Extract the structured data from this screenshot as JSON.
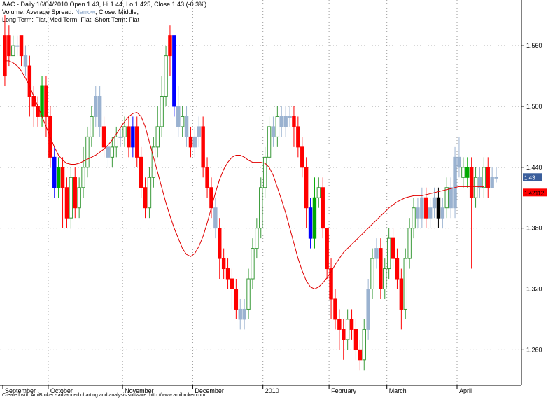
{
  "header": {
    "line1": "AAC - Daily 16/04/2010 Open 1.43, Hi 1.44, Lo 1.425, Close 1.43 (-0.3%)",
    "line2_prefix": "Volume: Average Spread:",
    "line2_narrow": "Narrow",
    "line2_suffix": ", Close: Middle,",
    "line3": "Long Term: Flat, Med Term: Flat, Short Term: Flat"
  },
  "footer": "Created with AmiBroker - advanced charting and analysis software. http://www.amibroker.com",
  "colors": {
    "up_body": "#ffffff",
    "up_border": "#3a9a3a",
    "down_body": "#ff0000",
    "neutral": "#9ab2d0",
    "ma_line": "#e00000",
    "grid": "#999999",
    "price_badge": "#3a5e9c",
    "ma_badge": "#ff0000"
  },
  "chart_data": {
    "type": "candlestick",
    "ylim": [
      1.225,
      1.605
    ],
    "y_ticks": [
      "1.560",
      "1.500",
      "1.440",
      "1.380",
      "1.320",
      "1.260"
    ],
    "x_labels": [
      "September",
      "October",
      "November",
      "December",
      "2010",
      "February",
      "March",
      "April"
    ],
    "last_price_label": "1.43",
    "ma_label": "1.42112",
    "candles": [
      [
        1.53,
        1.57,
        1.59,
        1.52,
        "d"
      ],
      [
        1.57,
        1.55,
        1.58,
        1.54,
        "d"
      ],
      [
        1.55,
        1.56,
        1.57,
        1.55,
        "u"
      ],
      [
        1.56,
        1.56,
        1.57,
        1.55,
        "n"
      ],
      [
        1.57,
        1.55,
        1.57,
        1.54,
        "d"
      ],
      [
        1.55,
        1.54,
        1.56,
        1.53,
        "n"
      ],
      [
        1.54,
        1.51,
        1.55,
        1.49,
        "d"
      ],
      [
        1.51,
        1.5,
        1.52,
        1.48,
        "d"
      ],
      [
        1.5,
        1.49,
        1.51,
        1.48,
        "d"
      ],
      [
        1.49,
        1.52,
        1.53,
        1.48,
        "g"
      ],
      [
        1.52,
        1.49,
        1.53,
        1.47,
        "d"
      ],
      [
        1.49,
        1.45,
        1.5,
        1.44,
        "d"
      ],
      [
        1.45,
        1.42,
        1.46,
        1.41,
        "b"
      ],
      [
        1.42,
        1.44,
        1.45,
        1.41,
        "g"
      ],
      [
        1.44,
        1.42,
        1.45,
        1.38,
        "d"
      ],
      [
        1.42,
        1.39,
        1.43,
        1.38,
        "d"
      ],
      [
        1.39,
        1.43,
        1.44,
        1.38,
        "u"
      ],
      [
        1.43,
        1.4,
        1.44,
        1.39,
        "d"
      ],
      [
        1.4,
        1.42,
        1.43,
        1.39,
        "u"
      ],
      [
        1.42,
        1.44,
        1.46,
        1.41,
        "u"
      ],
      [
        1.44,
        1.47,
        1.48,
        1.43,
        "u"
      ],
      [
        1.47,
        1.49,
        1.5,
        1.46,
        "u"
      ],
      [
        1.49,
        1.51,
        1.52,
        1.48,
        "n"
      ],
      [
        1.51,
        1.48,
        1.52,
        1.47,
        "n"
      ],
      [
        1.48,
        1.46,
        1.49,
        1.45,
        "d"
      ],
      [
        1.46,
        1.45,
        1.47,
        1.44,
        "n"
      ],
      [
        1.45,
        1.46,
        1.47,
        1.44,
        "u"
      ],
      [
        1.46,
        1.47,
        1.48,
        1.45,
        "u"
      ],
      [
        1.47,
        1.47,
        1.48,
        1.46,
        "n"
      ],
      [
        1.47,
        1.48,
        1.49,
        1.46,
        "u"
      ],
      [
        1.48,
        1.46,
        1.49,
        1.45,
        "d"
      ],
      [
        1.46,
        1.48,
        1.49,
        1.45,
        "b"
      ],
      [
        1.48,
        1.45,
        1.49,
        1.44,
        "d"
      ],
      [
        1.45,
        1.42,
        1.46,
        1.41,
        "d"
      ],
      [
        1.42,
        1.4,
        1.43,
        1.39,
        "d"
      ],
      [
        1.4,
        1.43,
        1.44,
        1.39,
        "u"
      ],
      [
        1.43,
        1.46,
        1.47,
        1.42,
        "u"
      ],
      [
        1.46,
        1.48,
        1.5,
        1.45,
        "u"
      ],
      [
        1.48,
        1.51,
        1.53,
        1.47,
        "u"
      ],
      [
        1.51,
        1.55,
        1.56,
        1.5,
        "u"
      ],
      [
        1.55,
        1.57,
        1.58,
        1.53,
        "d"
      ],
      [
        1.57,
        1.5,
        1.57,
        1.49,
        "b"
      ],
      [
        1.5,
        1.48,
        1.52,
        1.47,
        "n"
      ],
      [
        1.48,
        1.49,
        1.5,
        1.47,
        "u"
      ],
      [
        1.49,
        1.47,
        1.5,
        1.46,
        "n"
      ],
      [
        1.47,
        1.46,
        1.48,
        1.45,
        "d"
      ],
      [
        1.46,
        1.47,
        1.48,
        1.45,
        "n"
      ],
      [
        1.47,
        1.48,
        1.49,
        1.46,
        "n"
      ],
      [
        1.48,
        1.44,
        1.49,
        1.43,
        "d"
      ],
      [
        1.44,
        1.42,
        1.45,
        1.41,
        "d"
      ],
      [
        1.42,
        1.4,
        1.43,
        1.39,
        "d"
      ],
      [
        1.4,
        1.38,
        1.41,
        1.37,
        "n"
      ],
      [
        1.38,
        1.35,
        1.39,
        1.33,
        "d"
      ],
      [
        1.35,
        1.34,
        1.36,
        1.33,
        "d"
      ],
      [
        1.34,
        1.33,
        1.35,
        1.32,
        "d"
      ],
      [
        1.33,
        1.32,
        1.34,
        1.3,
        "d"
      ],
      [
        1.32,
        1.3,
        1.33,
        1.29,
        "d"
      ],
      [
        1.3,
        1.29,
        1.31,
        1.28,
        "n"
      ],
      [
        1.29,
        1.3,
        1.31,
        1.28,
        "n"
      ],
      [
        1.3,
        1.33,
        1.34,
        1.29,
        "u"
      ],
      [
        1.33,
        1.36,
        1.37,
        1.32,
        "u"
      ],
      [
        1.36,
        1.38,
        1.39,
        1.35,
        "u"
      ],
      [
        1.38,
        1.42,
        1.43,
        1.37,
        "u"
      ],
      [
        1.42,
        1.45,
        1.46,
        1.41,
        "u"
      ],
      [
        1.45,
        1.48,
        1.49,
        1.44,
        "u"
      ],
      [
        1.48,
        1.47,
        1.49,
        1.46,
        "n"
      ],
      [
        1.47,
        1.49,
        1.5,
        1.46,
        "u"
      ],
      [
        1.49,
        1.48,
        1.5,
        1.47,
        "n"
      ],
      [
        1.48,
        1.49,
        1.5,
        1.47,
        "n"
      ],
      [
        1.49,
        1.49,
        1.5,
        1.48,
        "n"
      ],
      [
        1.49,
        1.48,
        1.5,
        1.46,
        "d"
      ],
      [
        1.48,
        1.46,
        1.49,
        1.45,
        "d"
      ],
      [
        1.46,
        1.44,
        1.47,
        1.43,
        "d"
      ],
      [
        1.44,
        1.4,
        1.45,
        1.38,
        "d"
      ],
      [
        1.4,
        1.37,
        1.41,
        1.36,
        "b"
      ],
      [
        1.37,
        1.41,
        1.43,
        1.36,
        "g"
      ],
      [
        1.41,
        1.42,
        1.43,
        1.4,
        "u"
      ],
      [
        1.42,
        1.38,
        1.43,
        1.37,
        "d"
      ],
      [
        1.38,
        1.34,
        1.38,
        1.33,
        "d"
      ],
      [
        1.34,
        1.31,
        1.35,
        1.29,
        "d"
      ],
      [
        1.31,
        1.29,
        1.32,
        1.28,
        "d"
      ],
      [
        1.29,
        1.28,
        1.3,
        1.26,
        "d"
      ],
      [
        1.28,
        1.27,
        1.29,
        1.25,
        "d"
      ],
      [
        1.27,
        1.29,
        1.3,
        1.26,
        "u"
      ],
      [
        1.29,
        1.28,
        1.3,
        1.27,
        "d"
      ],
      [
        1.28,
        1.26,
        1.29,
        1.25,
        "d"
      ],
      [
        1.26,
        1.25,
        1.27,
        1.24,
        "d"
      ],
      [
        1.25,
        1.28,
        1.29,
        1.24,
        "u"
      ],
      [
        1.28,
        1.32,
        1.33,
        1.27,
        "n"
      ],
      [
        1.32,
        1.35,
        1.36,
        1.31,
        "u"
      ],
      [
        1.35,
        1.36,
        1.37,
        1.34,
        "n"
      ],
      [
        1.36,
        1.32,
        1.37,
        1.31,
        "d"
      ],
      [
        1.32,
        1.34,
        1.35,
        1.31,
        "u"
      ],
      [
        1.34,
        1.37,
        1.38,
        1.33,
        "u"
      ],
      [
        1.37,
        1.35,
        1.38,
        1.34,
        "d"
      ],
      [
        1.35,
        1.33,
        1.36,
        1.32,
        "d"
      ],
      [
        1.33,
        1.3,
        1.34,
        1.28,
        "d"
      ],
      [
        1.3,
        1.35,
        1.36,
        1.29,
        "u"
      ],
      [
        1.35,
        1.38,
        1.39,
        1.34,
        "u"
      ],
      [
        1.38,
        1.4,
        1.41,
        1.37,
        "u"
      ],
      [
        1.4,
        1.39,
        1.41,
        1.38,
        "n"
      ],
      [
        1.39,
        1.41,
        1.42,
        1.38,
        "n"
      ],
      [
        1.41,
        1.39,
        1.42,
        1.38,
        "d"
      ],
      [
        1.39,
        1.4,
        1.41,
        1.38,
        "n"
      ],
      [
        1.4,
        1.41,
        1.42,
        1.39,
        "n"
      ],
      [
        1.41,
        1.39,
        1.42,
        1.38,
        "k"
      ],
      [
        1.39,
        1.4,
        1.41,
        1.38,
        "n"
      ],
      [
        1.4,
        1.42,
        1.43,
        1.39,
        "u"
      ],
      [
        1.42,
        1.4,
        1.43,
        1.39,
        "n"
      ],
      [
        1.4,
        1.45,
        1.46,
        1.39,
        "n"
      ],
      [
        1.45,
        1.44,
        1.47,
        1.43,
        "n"
      ],
      [
        1.44,
        1.43,
        1.45,
        1.42,
        "u"
      ],
      [
        1.43,
        1.44,
        1.45,
        1.42,
        "g"
      ],
      [
        1.44,
        1.41,
        1.45,
        1.34,
        "d"
      ],
      [
        1.41,
        1.43,
        1.44,
        1.4,
        "u"
      ],
      [
        1.43,
        1.42,
        1.44,
        1.41,
        "n"
      ],
      [
        1.42,
        1.44,
        1.45,
        1.41,
        "u"
      ],
      [
        1.44,
        1.42,
        1.45,
        1.41,
        "d"
      ],
      [
        1.42,
        1.43,
        1.44,
        1.42,
        "n"
      ],
      [
        1.43,
        1.43,
        1.44,
        1.425,
        "n"
      ]
    ],
    "ma": [
      1.545,
      1.545,
      1.543,
      1.54,
      1.535,
      1.528,
      1.52,
      1.51,
      1.5,
      1.49,
      1.48,
      1.47,
      1.46,
      1.452,
      1.447,
      1.444,
      1.443,
      1.443,
      1.444,
      1.446,
      1.448,
      1.45,
      1.452,
      1.455,
      1.458,
      1.462,
      1.467,
      1.473,
      1.479,
      1.485,
      1.49,
      1.493,
      1.494,
      1.49,
      1.48,
      1.465,
      1.45,
      1.435,
      1.42,
      1.405,
      1.392,
      1.38,
      1.37,
      1.36,
      1.354,
      1.352,
      1.355,
      1.362,
      1.372,
      1.385,
      1.4,
      1.415,
      1.428,
      1.438,
      1.445,
      1.45,
      1.452,
      1.452,
      1.45,
      1.447,
      1.445,
      1.445,
      1.445,
      1.444,
      1.44,
      1.432,
      1.42,
      1.408,
      1.395,
      1.38,
      1.365,
      1.35,
      1.338,
      1.328,
      1.322,
      1.32,
      1.322,
      1.326,
      1.331,
      1.337,
      1.344,
      1.35,
      1.356,
      1.36,
      1.364,
      1.368,
      1.372,
      1.376,
      1.38,
      1.384,
      1.388,
      1.392,
      1.396,
      1.4,
      1.403,
      1.406,
      1.408,
      1.41,
      1.411,
      1.412,
      1.412,
      1.412,
      1.413,
      1.414,
      1.415,
      1.416,
      1.417,
      1.418,
      1.419,
      1.42,
      1.421,
      1.421,
      1.421,
      1.421,
      1.421,
      1.421,
      1.421
    ]
  }
}
